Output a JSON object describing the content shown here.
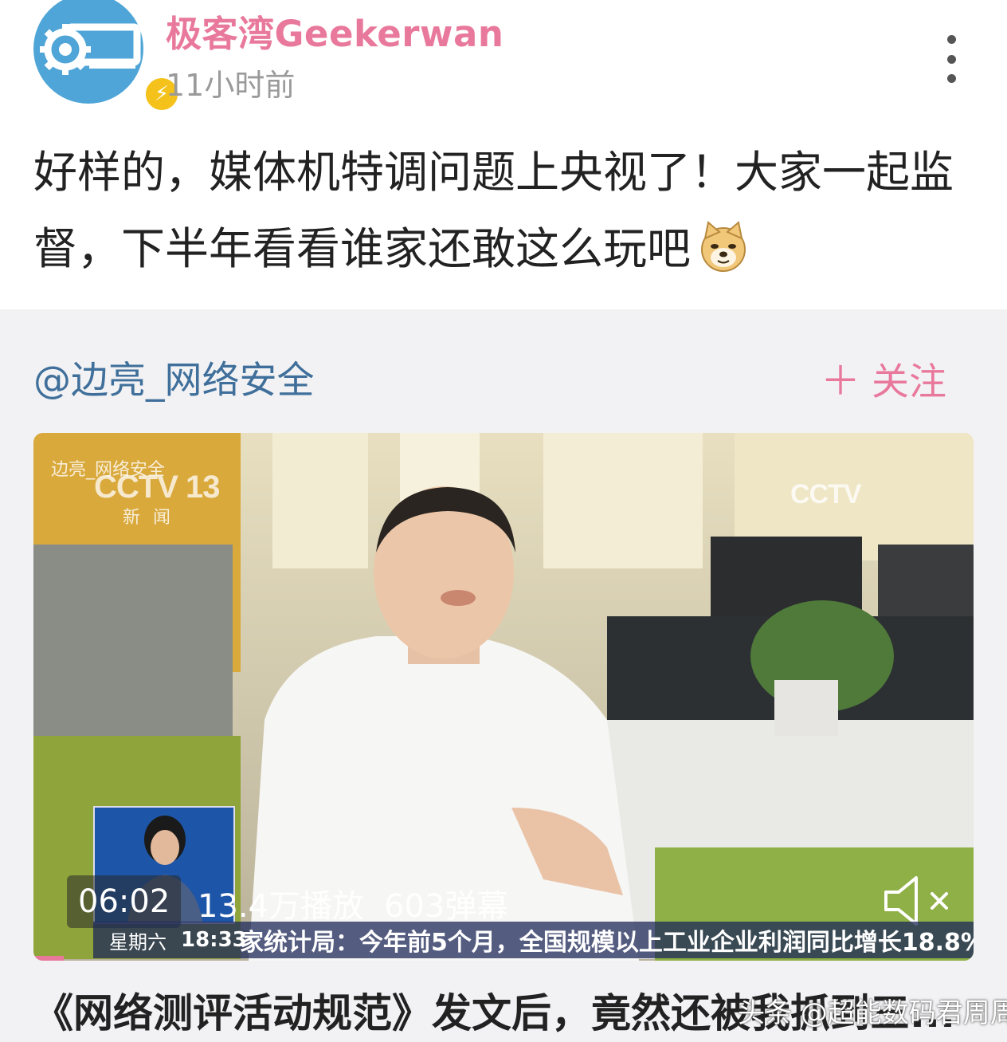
{
  "post": {
    "username": "极客湾Geekerwan",
    "timestamp": "11小时前",
    "text": "好样的，媒体机特调问题上央视了！大家一起监督，下半年看看谁家还敢这么玩吧",
    "emoji": "doge-icon"
  },
  "repost": {
    "author": "@边亮_网络安全",
    "follow_label": "关注",
    "follow_icon": "plus-icon",
    "video": {
      "watermark_top": "边亮_网络安全",
      "channel_logo": "CCTV 13",
      "channel_sub": "新闻",
      "corner_logo": "CCTV",
      "duration": "06:02",
      "plays": "13.4万播放",
      "danmaku": "603弹幕",
      "ticker_day": "星期六",
      "ticker_time": "18:33",
      "ticker_text": "家统计局：今年前5个月，全国规模以上工业企业利润同比增长18.8%"
    },
    "title": "《网络测评活动规范》发文后，竟然还被我抓到三...",
    "source_watermark": "头条 @超能数码君周周"
  },
  "colors": {
    "accent_pink": "#e9799c",
    "link_blue": "#3f6f9a",
    "card_bg": "#f2f2f4",
    "badge_yellow": "#f4c21b"
  }
}
